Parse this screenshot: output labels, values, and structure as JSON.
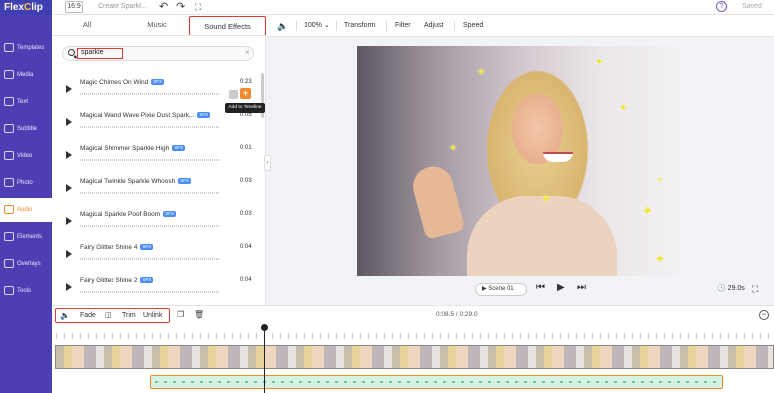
{
  "app": {
    "logo_main": "FlexClip",
    "ratio": "16:9",
    "project_name": "Create Sparkl...",
    "saved_label": "Saved",
    "help": "?"
  },
  "sidebar": {
    "items": [
      {
        "label": "Templates",
        "icon": "templates-icon"
      },
      {
        "label": "Media",
        "icon": "media-icon"
      },
      {
        "label": "Text",
        "icon": "text-icon"
      },
      {
        "label": "Subtitle",
        "icon": "subtitle-icon"
      },
      {
        "label": "Video",
        "icon": "video-icon"
      },
      {
        "label": "Photo",
        "icon": "photo-icon"
      },
      {
        "label": "Audio",
        "icon": "audio-icon",
        "active": true
      },
      {
        "label": "Elements",
        "icon": "elements-icon"
      },
      {
        "label": "Overlays",
        "icon": "overlays-icon"
      },
      {
        "label": "Tools",
        "icon": "tools-icon"
      }
    ]
  },
  "panel": {
    "tabs": [
      "All",
      "Music",
      "Sound Effects"
    ],
    "active_tab": "Sound Effects",
    "search": {
      "value": "sparkle"
    },
    "badge": "SFX",
    "tooltip": "Add to Timeline",
    "sounds": [
      {
        "name": "Magic Chimes On Wind",
        "duration": "0:23"
      },
      {
        "name": "Magical Wand Wave Pixie Dust Spark...",
        "duration": "0:05"
      },
      {
        "name": "Magical Shimmer Sparkle High",
        "duration": "0:01"
      },
      {
        "name": "Magical Twinkle Sparkle Whoosh",
        "duration": "0:03"
      },
      {
        "name": "Magical Sparkle Poof Boom",
        "duration": "0:03"
      },
      {
        "name": "Fairy Glitter Shine 4",
        "duration": "0:04"
      },
      {
        "name": "Fairy Glitter Shine 2",
        "duration": "0:04"
      }
    ]
  },
  "preview_toolbar": {
    "zoom": "100%",
    "transform": "Transform",
    "filter": "Filter",
    "adjust": "Adjust",
    "speed": "Speed"
  },
  "playback": {
    "scene": "Scene 01",
    "duration": "29.0s"
  },
  "timeline": {
    "fade": "Fade",
    "trim": "Trim",
    "unlink": "Unlink",
    "time": "0:08.5 / 0:29.0"
  },
  "colors": {
    "accent": "#f08a2c",
    "sidebar": "#4b3fb3",
    "highlight": "#e53935"
  }
}
